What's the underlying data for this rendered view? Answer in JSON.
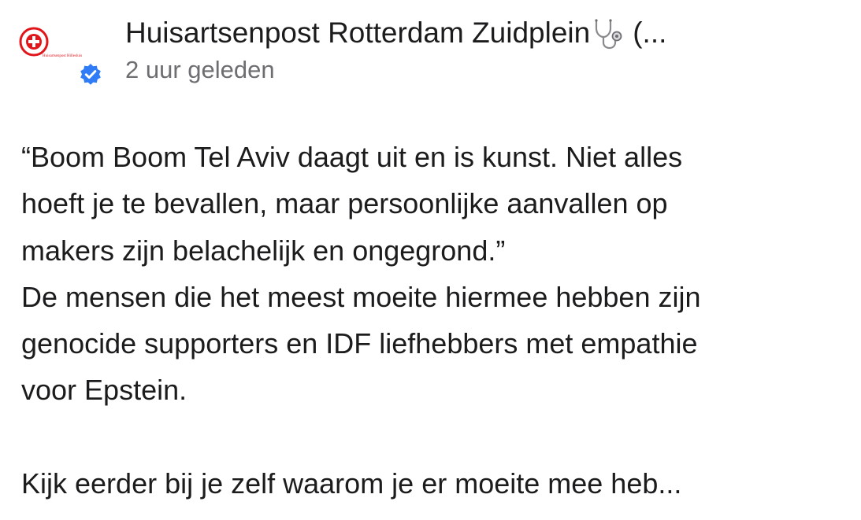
{
  "post": {
    "author": {
      "name": "Huisartsenpost Rotterdam Zuidplein",
      "name_suffix": "(...",
      "avatar_caption": "Huisartsenpost Hillesluis",
      "verified": true,
      "icons": {
        "emoji": "stethoscope-icon",
        "badge": "verified-badge-icon"
      }
    },
    "timestamp": "2 uur geleden",
    "body": {
      "lines": [
        "“Boom Boom Tel Aviv daagt uit en is kunst. Niet alles",
        "hoeft je te bevallen, maar persoonlijke aanvallen op",
        "makers zijn belachelijk en ongegrond.”",
        "De mensen die het meest moeite hiermee hebben zijn",
        "genocide supporters en IDF liefhebbers met empathie",
        "voor Epstein.",
        "",
        "Kijk eerder bij je zelf waarom je er moeite mee heb..."
      ]
    },
    "colors": {
      "text": "#1c1c1e",
      "secondary_text": "#6d6d72",
      "verified_blue": "#2f7cf6",
      "avatar_red": "#e0161b"
    }
  }
}
